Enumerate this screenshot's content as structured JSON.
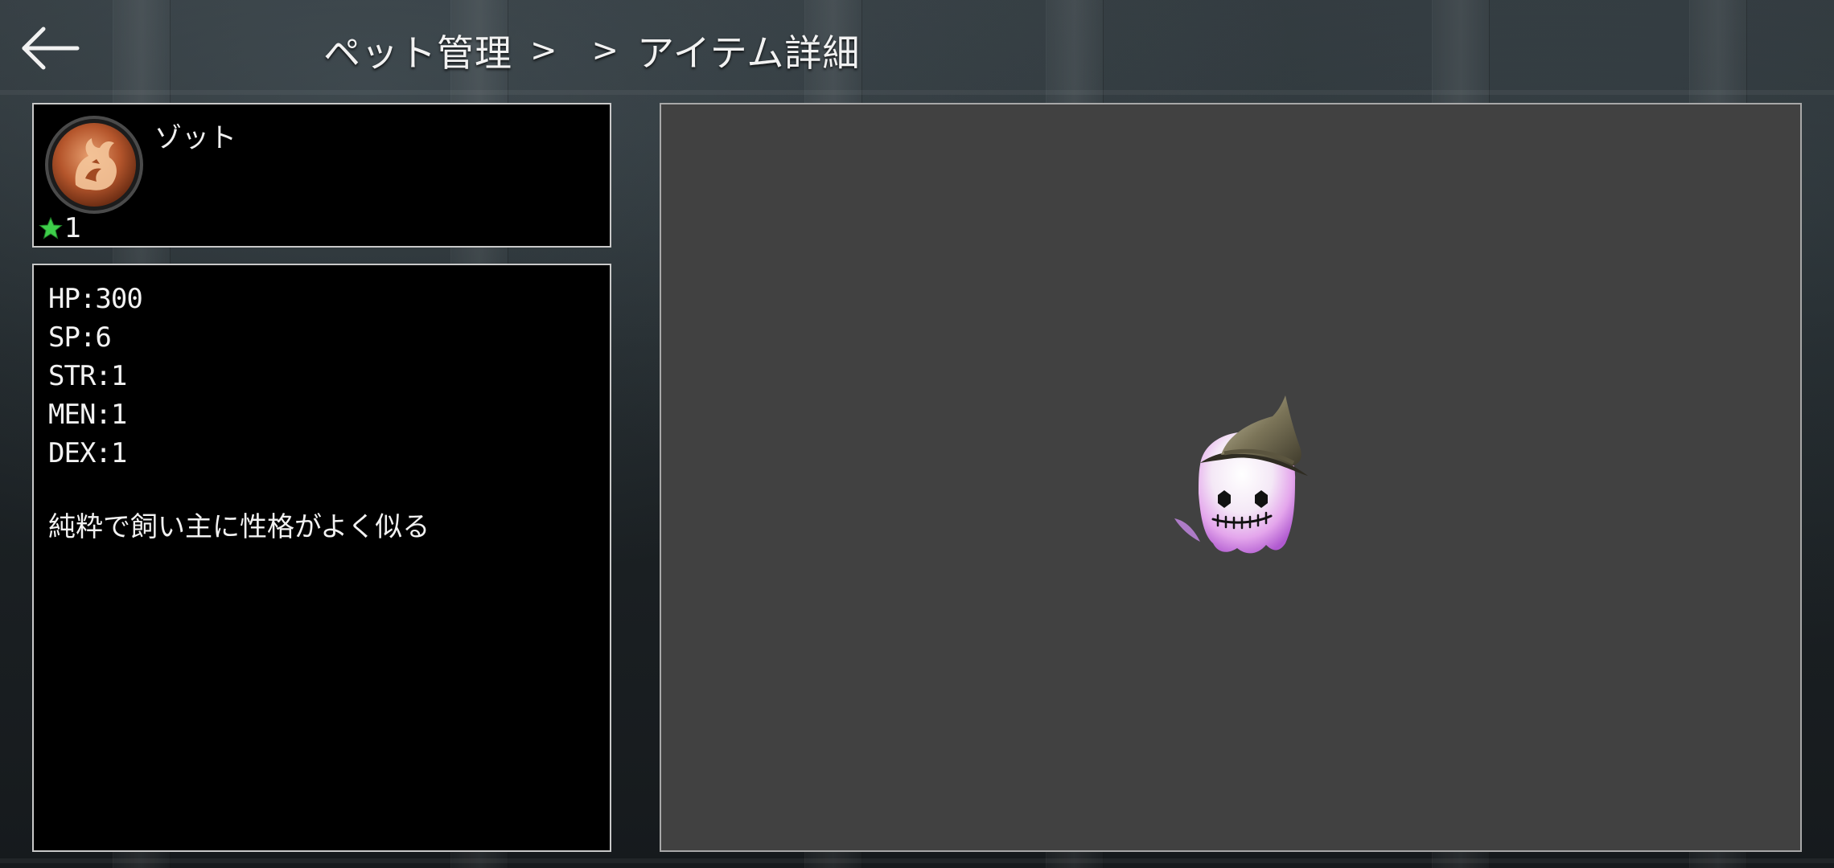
{
  "header": {
    "breadcrumb": {
      "pet_management": "ペット管理",
      "separator_1": ">",
      "separator_2": ">",
      "current": "アイテム詳細"
    }
  },
  "pet": {
    "name": "ゾット",
    "rank": "1",
    "icon": "fox-crest-icon"
  },
  "stats": [
    "HP:300",
    "SP:6",
    "STR:1",
    "MEN:1",
    "DEX:1"
  ],
  "description": "純粋で飼い主に性格がよく似る",
  "colors": {
    "panel_border": "#c9c9c9",
    "preview_bg": "#414141",
    "rank_star": "#3ecf4a",
    "icon_bronze": "#c86a3c"
  }
}
